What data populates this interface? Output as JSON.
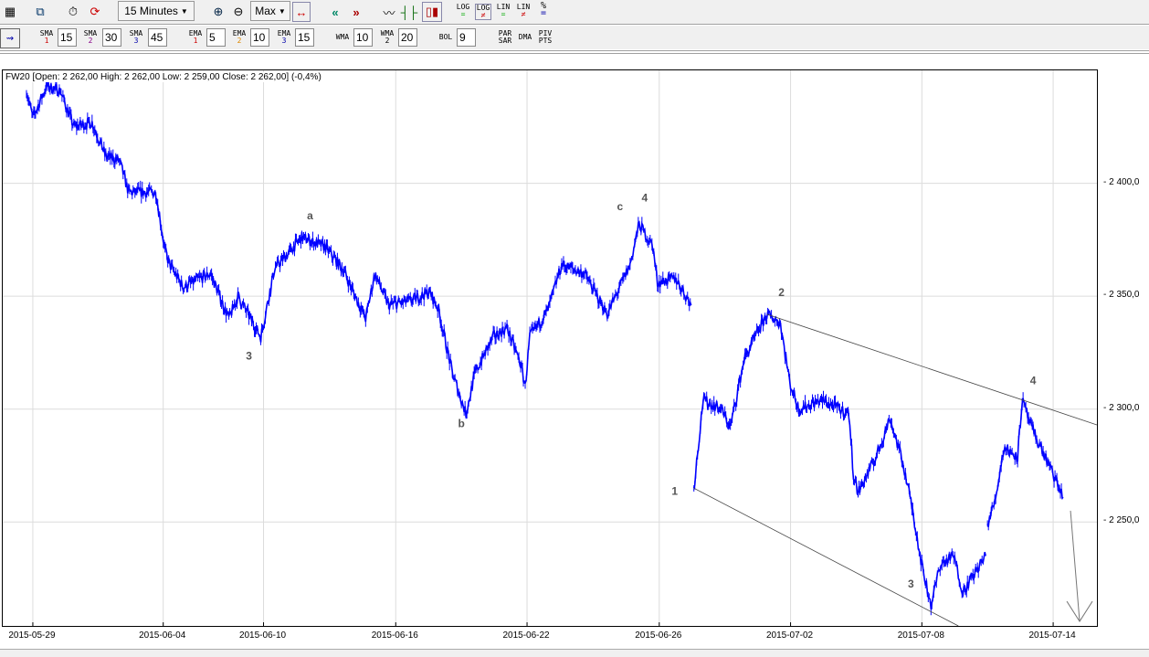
{
  "toolbar": {
    "interval": "15 Minutes",
    "range": "Max",
    "icons": [
      "chart-window-icon",
      "new-window-icon",
      "timer-icon",
      "refresh-icon",
      "zoom-in-icon",
      "zoom-out-icon",
      "fit-icon",
      "scroll-left-icon",
      "scroll-right-icon",
      "line-chart-icon",
      "ohlc-chart-icon",
      "candle-chart-icon"
    ],
    "scale": [
      {
        "top": "LOG",
        "bot": "="
      },
      {
        "top": "LOG",
        "bot": "≠"
      },
      {
        "top": "LIN",
        "bot": "="
      },
      {
        "top": "LIN",
        "bot": "≠"
      },
      {
        "top": "%",
        "bot": "="
      }
    ]
  },
  "indicators": {
    "sma": [
      {
        "label": "SMA",
        "n": "1",
        "value": "15"
      },
      {
        "label": "SMA",
        "n": "2",
        "value": "30"
      },
      {
        "label": "SMA",
        "n": "3",
        "value": "45"
      }
    ],
    "ema": [
      {
        "label": "EMA",
        "n": "1",
        "value": "5"
      },
      {
        "label": "EMA",
        "n": "2",
        "value": "10"
      },
      {
        "label": "EMA",
        "n": "3",
        "value": "15"
      }
    ],
    "wma": [
      {
        "label": "WMA",
        "n": "",
        "value": "10"
      },
      {
        "label": "WMA",
        "n": "2",
        "value": "20"
      }
    ],
    "bol": {
      "label": "BOL",
      "value": "9"
    },
    "parsar": {
      "top": "PAR",
      "bot": "SAR"
    },
    "dma": "DMA",
    "pivpts": {
      "top": "PIV",
      "bot": "PTS"
    }
  },
  "chart_data": {
    "type": "line",
    "title": "FW20 [Open: 2 262,00  High: 2 262,00  Low: 2 259,00  Close: 2 262,00] (-0,4%)",
    "x_unit": "15-minute bar index",
    "xlim": [
      -26,
      1174
    ],
    "ylim": [
      2204,
      2450
    ],
    "x_ticks": [
      {
        "x": 7,
        "label": "2015-05-29"
      },
      {
        "x": 150,
        "label": "2015-06-04"
      },
      {
        "x": 260,
        "label": "2015-06-10"
      },
      {
        "x": 405,
        "label": "2015-06-16"
      },
      {
        "x": 549,
        "label": "2015-06-22"
      },
      {
        "x": 694,
        "label": "2015-06-26"
      },
      {
        "x": 838,
        "label": "2015-07-02"
      },
      {
        "x": 982,
        "label": "2015-07-08"
      },
      {
        "x": 1126,
        "label": "2015-07-14"
      }
    ],
    "y_ticks": [
      {
        "y": 2400,
        "label": "2 400,0"
      },
      {
        "y": 2350,
        "label": "2 350,0"
      },
      {
        "y": 2300,
        "label": "2 300,0"
      },
      {
        "y": 2250,
        "label": "2 250,0"
      }
    ],
    "series": [
      {
        "name": "FW20",
        "color": "#0000ff",
        "segments": [
          [
            [
              0,
              2441
            ],
            [
              7,
              2429
            ],
            [
              22,
              2443
            ],
            [
              37,
              2441
            ],
            [
              52,
              2425
            ],
            [
              72,
              2427
            ],
            [
              87,
              2412
            ],
            [
              102,
              2410
            ],
            [
              112,
              2396
            ],
            [
              142,
              2396
            ],
            [
              152,
              2370
            ],
            [
              157,
              2364
            ],
            [
              172,
              2354
            ],
            [
              202,
              2360
            ],
            [
              222,
              2340
            ],
            [
              232,
              2350
            ],
            [
              257,
              2332
            ],
            [
              272,
              2362
            ],
            [
              302,
              2376
            ],
            [
              327,
              2372
            ],
            [
              347,
              2362
            ],
            [
              372,
              2340
            ],
            [
              382,
              2360
            ],
            [
              397,
              2346
            ],
            [
              422,
              2348
            ],
            [
              442,
              2352
            ],
            [
              452,
              2344
            ],
            [
              467,
              2316
            ],
            [
              482,
              2298
            ],
            [
              492,
              2316
            ],
            [
              512,
              2332
            ],
            [
              527,
              2336
            ],
            [
              542,
              2320
            ],
            [
              547,
              2310
            ],
            [
              552,
              2332
            ],
            [
              572,
              2344
            ],
            [
              587,
              2364
            ],
            [
              612,
              2360
            ],
            [
              637,
              2342
            ],
            [
              662,
              2364
            ],
            [
              672,
              2382
            ],
            [
              687,
              2372
            ],
            [
              692,
              2356
            ],
            [
              712,
              2358
            ],
            [
              729,
              2346
            ]
          ],
          [
            [
              732,
              2265
            ],
            [
              742,
              2304
            ],
            [
              762,
              2300
            ],
            [
              772,
              2292
            ],
            [
              787,
              2322
            ],
            [
              812,
              2342
            ],
            [
              827,
              2338
            ],
            [
              837,
              2312
            ],
            [
              847,
              2300
            ],
            [
              872,
              2304
            ],
            [
              902,
              2298
            ],
            [
              907,
              2271
            ],
            [
              912,
              2263
            ],
            [
              932,
              2279
            ],
            [
              947,
              2296
            ],
            [
              962,
              2275
            ],
            [
              972,
              2255
            ],
            [
              982,
              2231
            ],
            [
              992,
              2213
            ],
            [
              1002,
              2231
            ],
            [
              1017,
              2235
            ],
            [
              1027,
              2219
            ],
            [
              1052,
              2235
            ]
          ],
          [
            [
              1054,
              2249
            ],
            [
              1062,
              2259
            ],
            [
              1072,
              2283
            ],
            [
              1087,
              2279
            ],
            [
              1092,
              2304
            ],
            [
              1102,
              2292
            ],
            [
              1117,
              2279
            ],
            [
              1137,
              2261
            ]
          ]
        ]
      }
    ],
    "trendlines": [
      {
        "from": [
          812,
          2342
        ],
        "to": [
          1174,
          2293
        ]
      },
      {
        "from": [
          732,
          2265
        ],
        "to": [
          1022,
          2204
        ]
      }
    ],
    "arrow": {
      "from": [
        1145,
        2255
      ],
      "to": [
        1155,
        2206
      ]
    },
    "annotations": [
      {
        "text": "a",
        "x": 311,
        "y": 2384
      },
      {
        "text": "3",
        "x": 244,
        "y": 2322
      },
      {
        "text": "b",
        "x": 477,
        "y": 2292
      },
      {
        "text": "c",
        "x": 651,
        "y": 2388
      },
      {
        "text": "4",
        "x": 678,
        "y": 2392
      },
      {
        "text": "1",
        "x": 711,
        "y": 2262
      },
      {
        "text": "2",
        "x": 828,
        "y": 2350
      },
      {
        "text": "3",
        "x": 970,
        "y": 2221
      },
      {
        "text": "4",
        "x": 1104,
        "y": 2311
      }
    ]
  }
}
